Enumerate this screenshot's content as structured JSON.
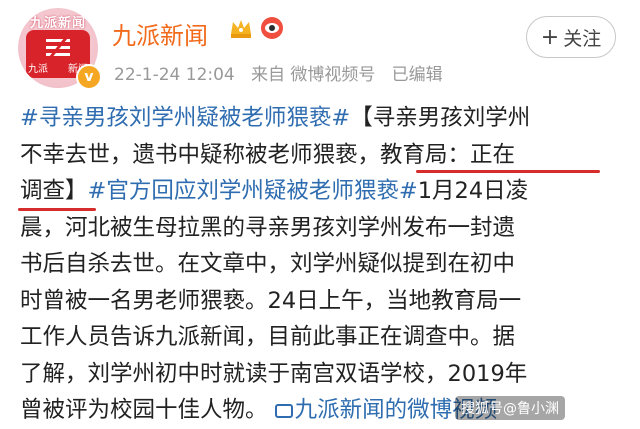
{
  "post": {
    "avatar_caption": "九派新闻",
    "avatar_left": "九派",
    "avatar_right": "新闻",
    "author_name": "九派新闻",
    "date_time": "22-1-24 12:04",
    "from_label": "来自",
    "source": "微博视频号",
    "edited": "已编辑",
    "follow_label": "关注",
    "follow_plus": "+",
    "verified_mark": "v",
    "lines": [
      [
        "#寻亲男孩刘学州疑被老师猥亵#",
        "【寻亲男孩刘学州"
      ],
      [
        "不幸去世，遗书中疑称被老师猥亵，教育局：正在"
      ],
      [
        "调查】",
        "#官方回应刘学州疑被老师猥亵#",
        "1月24日凌"
      ],
      [
        "晨，河北被生母拉黑的寻亲男孩刘学州发布一封遗"
      ],
      [
        "书后自杀去世。在文章中，刘学州疑似提到在初中"
      ],
      [
        "时曾被一名男老师猥亵。24日上午，当地教育局一"
      ],
      [
        "工作人员告诉九派新闻，目前此事正在调查中。据"
      ],
      [
        "了解，刘学州初中时就读于南宫双语学校，2019年"
      ],
      [
        "曾被评为校园十佳人物。",
        "九派新闻的微博视频"
      ]
    ],
    "watermark": "搜狐号@鲁小渊"
  }
}
